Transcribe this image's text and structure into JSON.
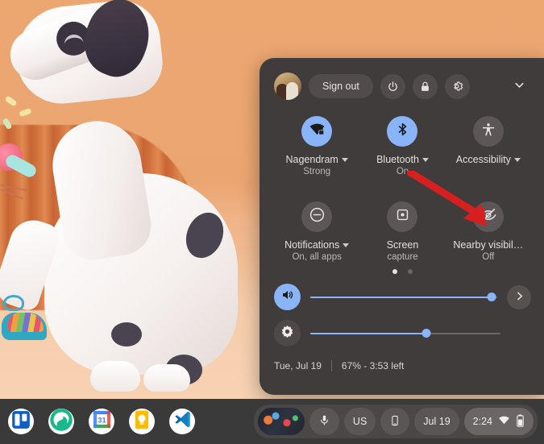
{
  "wallpaper": {
    "description": "3D illustration of a dalmatian dog with red collar on orange background",
    "bg_color": "#eca771"
  },
  "quick_settings": {
    "header": {
      "avatar_name": "user-avatar",
      "sign_out_label": "Sign out",
      "power_icon": "power-icon",
      "lock_icon": "lock-icon",
      "settings_icon": "gear-icon",
      "collapse_icon": "chevron-down-icon"
    },
    "tiles": [
      {
        "id": "network",
        "icon": "wifi-locked-icon",
        "label": "Nagendram",
        "sublabel": "Strong",
        "state": "on",
        "has_caret": true
      },
      {
        "id": "bluetooth",
        "icon": "bluetooth-icon",
        "label": "Bluetooth",
        "sublabel": "On",
        "state": "on",
        "has_caret": true
      },
      {
        "id": "accessibility",
        "icon": "accessibility-icon",
        "label": "Accessibility",
        "sublabel": "",
        "state": "off",
        "has_caret": true
      },
      {
        "id": "notifications",
        "icon": "do-not-disturb-icon",
        "label": "Notifications",
        "sublabel": "On, all apps",
        "state": "off",
        "has_caret": true
      },
      {
        "id": "screen-capture",
        "icon": "screen-capture-icon",
        "label": "Screen",
        "label2": "capture",
        "sublabel": "",
        "state": "off",
        "has_caret": false
      },
      {
        "id": "nearby-visibility",
        "icon": "eye-off-icon",
        "label": "Nearby visibil…",
        "sublabel": "Off",
        "state": "off",
        "has_caret": false
      }
    ],
    "pagination": {
      "total": 2,
      "active": 1
    },
    "volume_slider": {
      "icon": "volume-up-icon",
      "value": 97,
      "expand_icon": "chevron-right-icon"
    },
    "brightness_slider": {
      "icon": "brightness-icon",
      "value": 61
    },
    "footer": {
      "date": "Tue, Jul 19",
      "battery": "67% - 3:53 left"
    }
  },
  "annotation": {
    "type": "arrow",
    "color": "#d81f1f",
    "points_to": "nearby-visibility-tile"
  },
  "shelf": {
    "apps": [
      {
        "id": "trello",
        "name": "trello-icon"
      },
      {
        "id": "green-app",
        "name": "app-icon-green"
      },
      {
        "id": "calendar",
        "name": "google-calendar-icon",
        "day": "31"
      },
      {
        "id": "keep",
        "name": "google-keep-icon"
      },
      {
        "id": "vscode",
        "name": "vs-code-icon"
      }
    ],
    "status": {
      "screenshot_thumb": "screenshot-thumbnail",
      "mic_icon": "microphone-icon",
      "ime_label": "US",
      "phone_icon": "phone-hub-icon",
      "date_label": "Jul 19",
      "time_label": "2:24",
      "wifi_icon": "wifi-icon",
      "battery_icon": "battery-icon"
    }
  },
  "colors": {
    "panel_bg": "#413c3c",
    "accent_blue": "#8ab4f8",
    "tile_off": "#5c5656",
    "shelf_bg": "#3b3a3a",
    "arrow_red": "#d81f1f"
  }
}
